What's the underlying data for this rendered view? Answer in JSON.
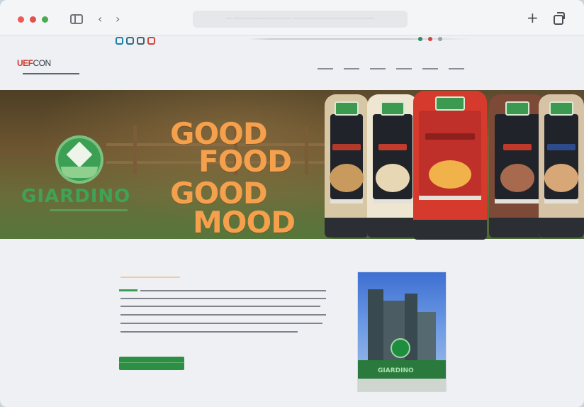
{
  "browser": {
    "address_text": "— —————————— ——————————————",
    "icons": [
      "sidebar-icon",
      "back-icon",
      "forward-icon",
      "new-tab-icon",
      "tabs-overview-icon"
    ],
    "window_buttons": {
      "close": "#ec5b55",
      "minimize": "#e4504a",
      "zoom": "#4caa52"
    }
  },
  "site": {
    "logo": {
      "red_part": "UEF",
      "dark_part": "CON"
    },
    "nav_items": 6
  },
  "banner": {
    "brand": "GIARDINO",
    "slogan": [
      "GOOD",
      "FOOD",
      "GOOD",
      "MOOD"
    ],
    "bottle_colors": [
      "#d8c7a4",
      "#efe6d2",
      "#d63a2c",
      "#7c4a37",
      "#d6c3a5"
    ]
  },
  "content": {
    "button_label": "———————————————————",
    "building_sign": "GIARDINO"
  },
  "colors": {
    "accent_green": "#3e9d54",
    "slogan_orange": "#f4a04c",
    "logo_red": "#d13b2f"
  }
}
